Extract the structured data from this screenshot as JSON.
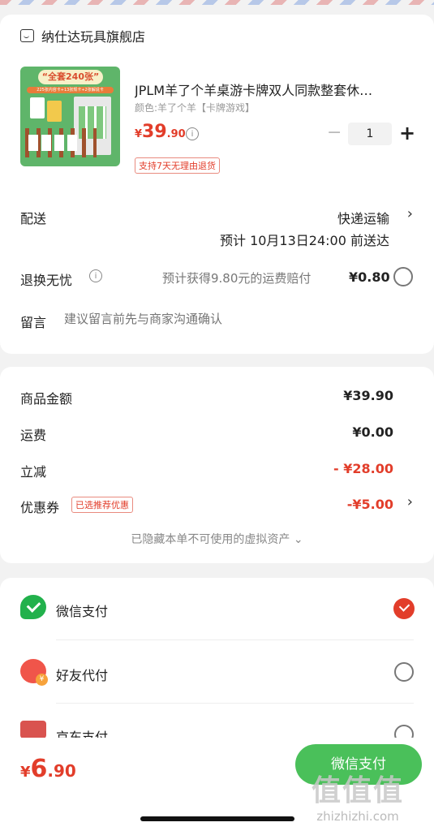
{
  "shop": {
    "name": "纳仕达玩具旗舰店",
    "icon": "shop-icon"
  },
  "product": {
    "image_banner": "“全套240张”",
    "image_sub": "225张内容卡+13张规卡+2张解说卡",
    "title": "JPLM羊了个羊桌游卡牌双人同款整套休…",
    "spec": "颜色:羊了个羊【卡牌游戏】",
    "price_symbol": "¥",
    "price_int": "39",
    "price_dec": ".90",
    "quantity": "1",
    "minus_label": "−",
    "plus_label": "+",
    "refund_tag": "支持7天无理由退货"
  },
  "delivery": {
    "label": "配送",
    "method": "快递运输",
    "eta": "预计 10月13日24:00 前送达"
  },
  "return_insurance": {
    "label": "退换无忧",
    "desc": "预计获得9.80元的运费赔付",
    "price": "¥0.80"
  },
  "message": {
    "label": "留言",
    "placeholder": "建议留言前先与商家沟通确认"
  },
  "summary": {
    "goods_label": "商品金额",
    "goods_value": "¥39.90",
    "shipping_label": "运费",
    "shipping_value": "¥0.00",
    "discount_label": "立减",
    "discount_value": "- ¥28.00",
    "coupon_label": "优惠券",
    "coupon_tag": "已选推荐优惠",
    "coupon_value": "-¥5.00",
    "hidden_assets": "已隐藏本单不可使用的虚拟资产 ⌄"
  },
  "payment": {
    "methods": [
      {
        "label": "微信支付",
        "icon": "wechat-pay-icon",
        "selected": true
      },
      {
        "label": "好友代付",
        "icon": "friend-pay-icon",
        "selected": false
      },
      {
        "label": "京东支付",
        "icon": "jd-pay-icon",
        "selected": false
      }
    ]
  },
  "footer": {
    "total_symbol": "¥",
    "total_int": "6",
    "total_dec": ".90",
    "pay_button": "微信支付"
  },
  "watermark": {
    "big": "值值值",
    "small": "zhizhizhi.com"
  },
  "colors": {
    "accent": "#e23d2a",
    "wechat_green": "#4ac05a",
    "background": "#f2f2f2"
  }
}
